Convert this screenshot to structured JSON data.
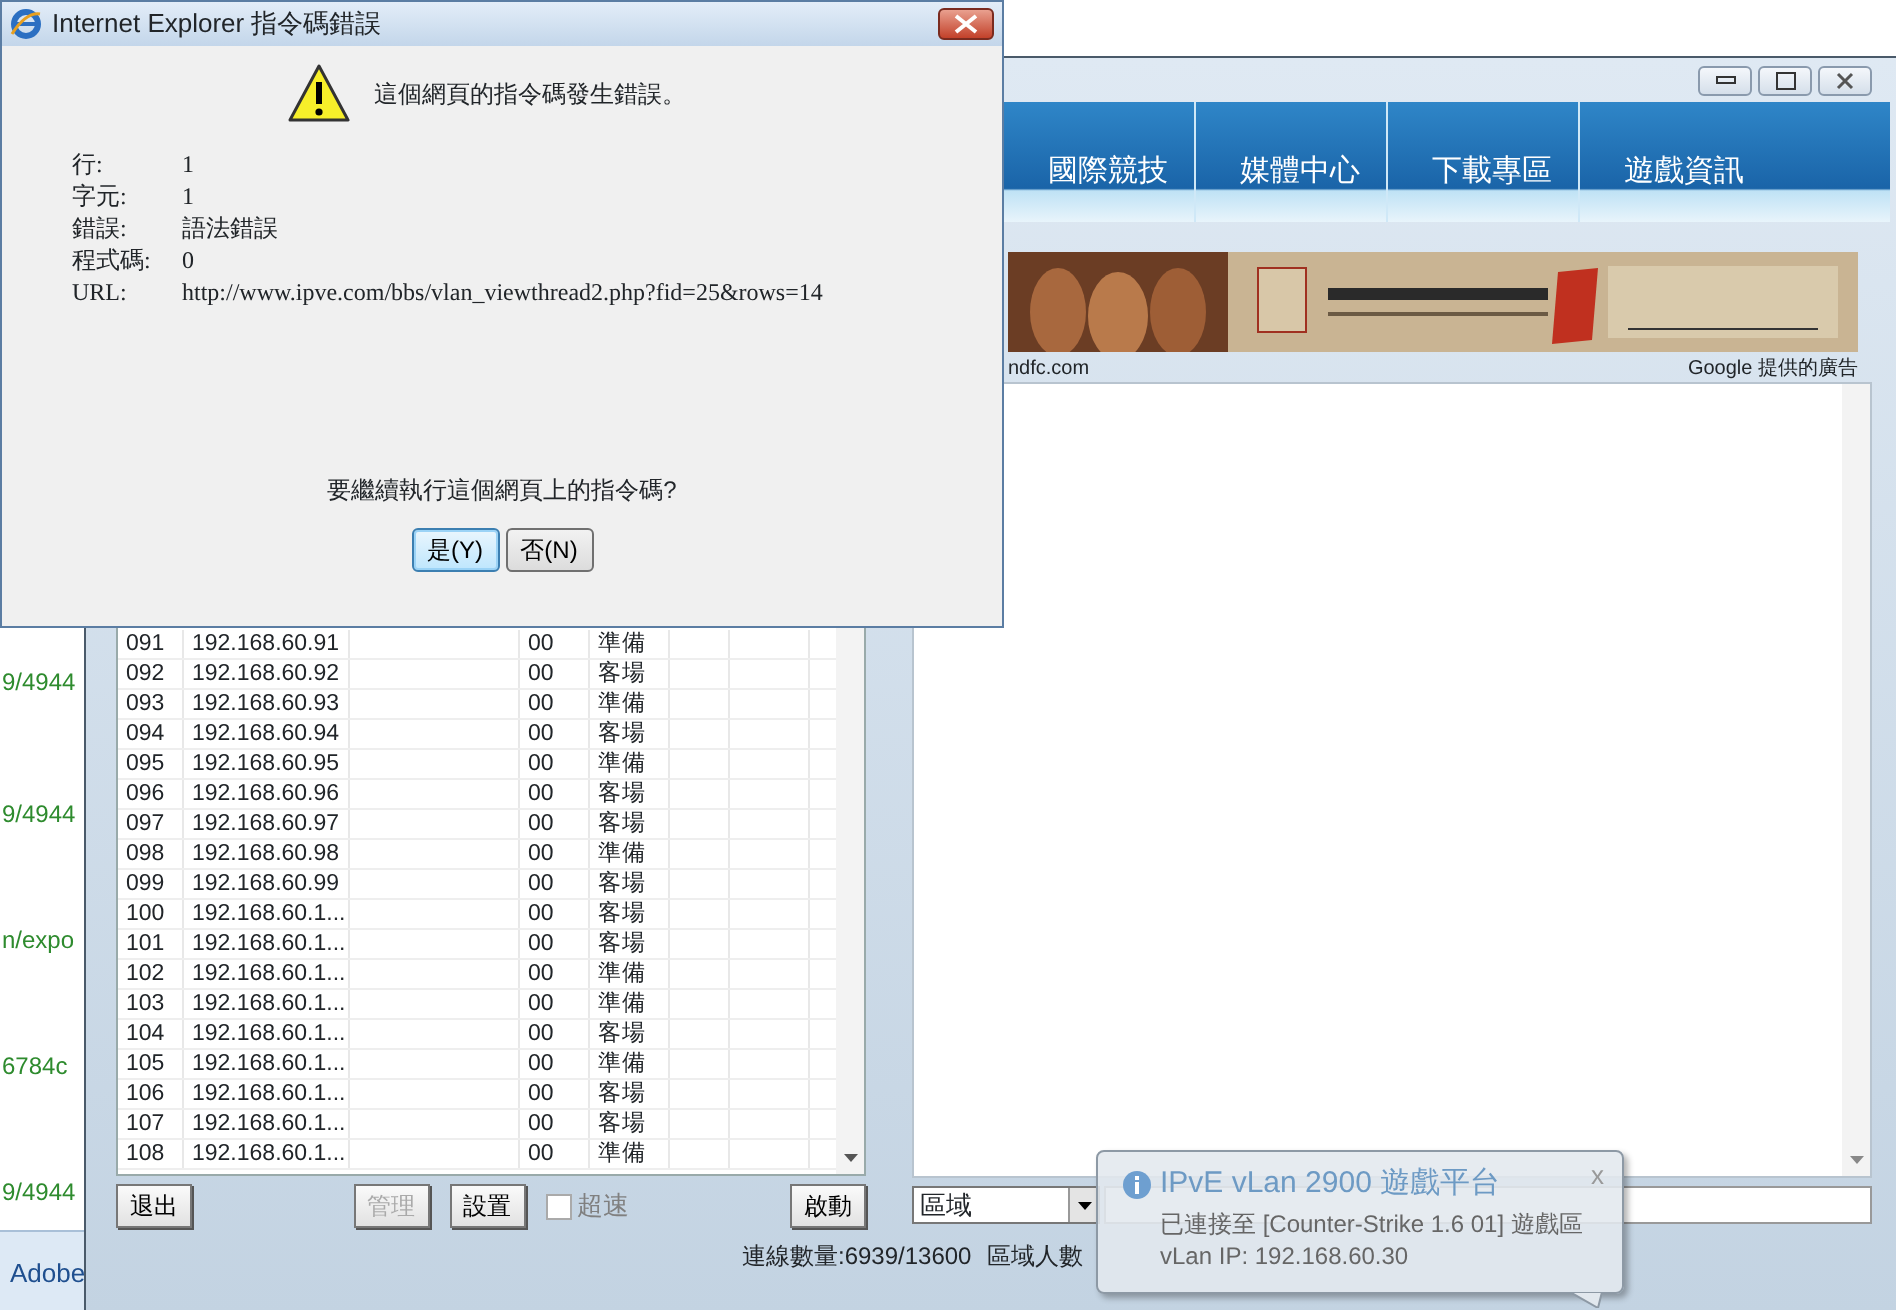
{
  "error_dialog": {
    "title": "Internet Explorer 指令碼錯誤",
    "message": "這個網頁的指令碼發生錯誤。",
    "details": [
      {
        "label": "行:",
        "value": "1"
      },
      {
        "label": "字元:",
        "value": "1"
      },
      {
        "label": "錯誤:",
        "value": "語法錯誤"
      },
      {
        "label": "程式碼:",
        "value": "0"
      },
      {
        "label": "URL:",
        "value": "http://www.ipve.com/bbs/vlan_viewthread2.php?fid=25&rows=14"
      }
    ],
    "question": "要繼續執行這個網頁上的指令碼?",
    "buttons": [
      {
        "label": "是(Y)",
        "selected": true
      },
      {
        "label": "否(N)",
        "selected": false
      }
    ]
  },
  "background_page": {
    "link_fragments": [
      "9/4944",
      "9/4944",
      "n/expo",
      "6784c",
      "9/4944"
    ],
    "taskbar_item": "Adobe"
  },
  "app_window": {
    "nav_tabs": [
      "國際競技",
      "媒體中心",
      "下載專區",
      "遊戲資訊"
    ],
    "banner": {
      "kind": "picture"
    },
    "ad_source": "ndfc.com",
    "ad_label": "Google 提供的廣告",
    "players": [
      {
        "number": "091",
        "ip": "192.168.60.91",
        "value": "00",
        "status": "準備"
      },
      {
        "number": "092",
        "ip": "192.168.60.92",
        "value": "00",
        "status": "客場"
      },
      {
        "number": "093",
        "ip": "192.168.60.93",
        "value": "00",
        "status": "準備"
      },
      {
        "number": "094",
        "ip": "192.168.60.94",
        "value": "00",
        "status": "客場"
      },
      {
        "number": "095",
        "ip": "192.168.60.95",
        "value": "00",
        "status": "準備"
      },
      {
        "number": "096",
        "ip": "192.168.60.96",
        "value": "00",
        "status": "客場"
      },
      {
        "number": "097",
        "ip": "192.168.60.97",
        "value": "00",
        "status": "客場"
      },
      {
        "number": "098",
        "ip": "192.168.60.98",
        "value": "00",
        "status": "準備"
      },
      {
        "number": "099",
        "ip": "192.168.60.99",
        "value": "00",
        "status": "客場"
      },
      {
        "number": "100",
        "ip": "192.168.60.1...",
        "value": "00",
        "status": "客場"
      },
      {
        "number": "101",
        "ip": "192.168.60.1...",
        "value": "00",
        "status": "客場"
      },
      {
        "number": "102",
        "ip": "192.168.60.1...",
        "value": "00",
        "status": "準備"
      },
      {
        "number": "103",
        "ip": "192.168.60.1...",
        "value": "00",
        "status": "準備"
      },
      {
        "number": "104",
        "ip": "192.168.60.1...",
        "value": "00",
        "status": "客場"
      },
      {
        "number": "105",
        "ip": "192.168.60.1...",
        "value": "00",
        "status": "準備"
      },
      {
        "number": "106",
        "ip": "192.168.60.1...",
        "value": "00",
        "status": "客場"
      },
      {
        "number": "107",
        "ip": "192.168.60.1...",
        "value": "00",
        "status": "客場"
      },
      {
        "number": "108",
        "ip": "192.168.60.1...",
        "value": "00",
        "status": "準備"
      }
    ],
    "buttons": [
      {
        "label": "退出",
        "disabled": false
      },
      {
        "label": "管理",
        "disabled": true
      },
      {
        "label": "設置",
        "disabled": false
      }
    ],
    "speed_checkbox": {
      "label": "超速",
      "checked": false,
      "disabled": true
    },
    "start_button": "啟動",
    "region_select": {
      "value": "區域"
    },
    "status": {
      "connections": "連線數量:6939/13600",
      "region_players": "區域人數"
    }
  },
  "notification": {
    "title": "IPvE vLan 2900 遊戲平台",
    "close": "x",
    "lines": [
      "已連接至 [Counter-Strike 1.6  01] 遊戲區",
      "vLan IP: 192.168.60.30"
    ]
  }
}
